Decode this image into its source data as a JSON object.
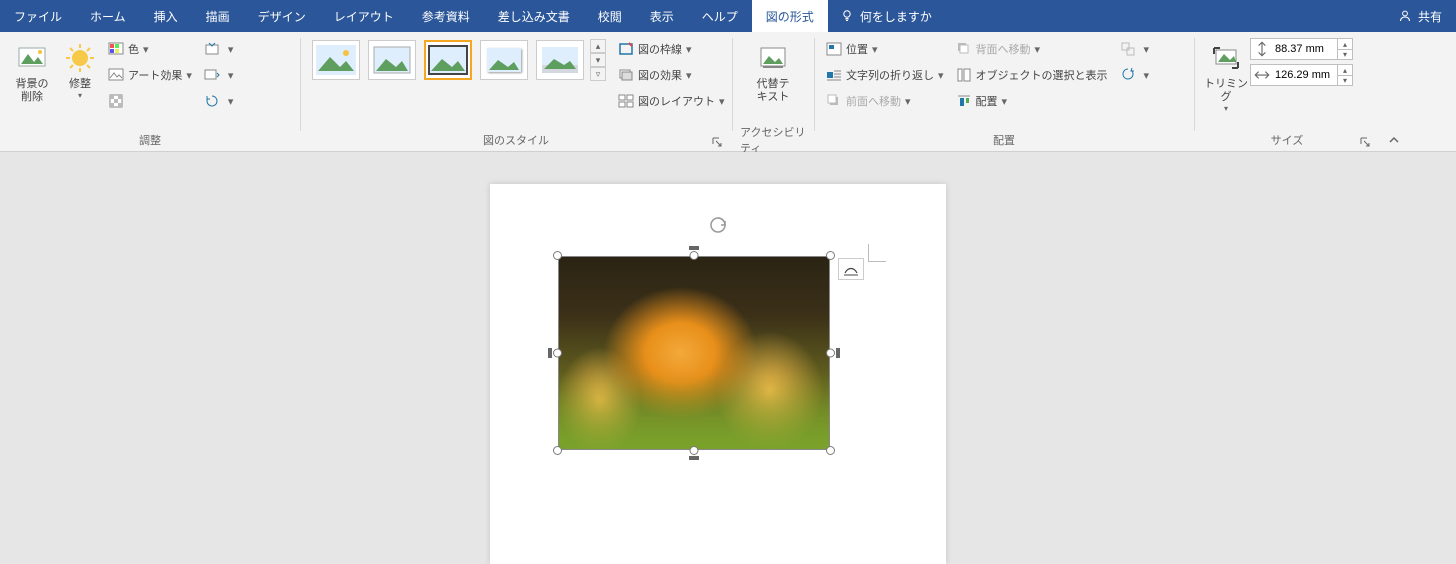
{
  "tabs": {
    "file": "ファイル",
    "home": "ホーム",
    "insert": "挿入",
    "draw": "描画",
    "design": "デザイン",
    "layout": "レイアウト",
    "references": "参考資料",
    "mailings": "差し込み文書",
    "review": "校閲",
    "view": "表示",
    "help": "ヘルプ",
    "picture_format": "図の形式"
  },
  "tellme": {
    "placeholder": "何をしますか"
  },
  "share": {
    "label": "共有"
  },
  "ribbon": {
    "adjust": {
      "label": "調整",
      "remove_bg": "背景の\n削除",
      "corrections": "修整",
      "color": "色",
      "artistic": "アート効果"
    },
    "styles": {
      "label": "図のスタイル",
      "border": "図の枠線",
      "effects": "図の効果",
      "layout": "図のレイアウト"
    },
    "accessibility": {
      "label": "アクセシビリティ",
      "alt_text": "代替テ\nキスト"
    },
    "arrange": {
      "label": "配置",
      "position": "位置",
      "wrap": "文字列の折り返し",
      "forward": "前面へ移動",
      "backward": "背面へ移動",
      "selection_pane": "オブジェクトの選択と表示",
      "align": "配置"
    },
    "size": {
      "label": "サイズ",
      "crop": "トリミング",
      "height": "88.37 mm",
      "width": "126.29 mm"
    }
  }
}
